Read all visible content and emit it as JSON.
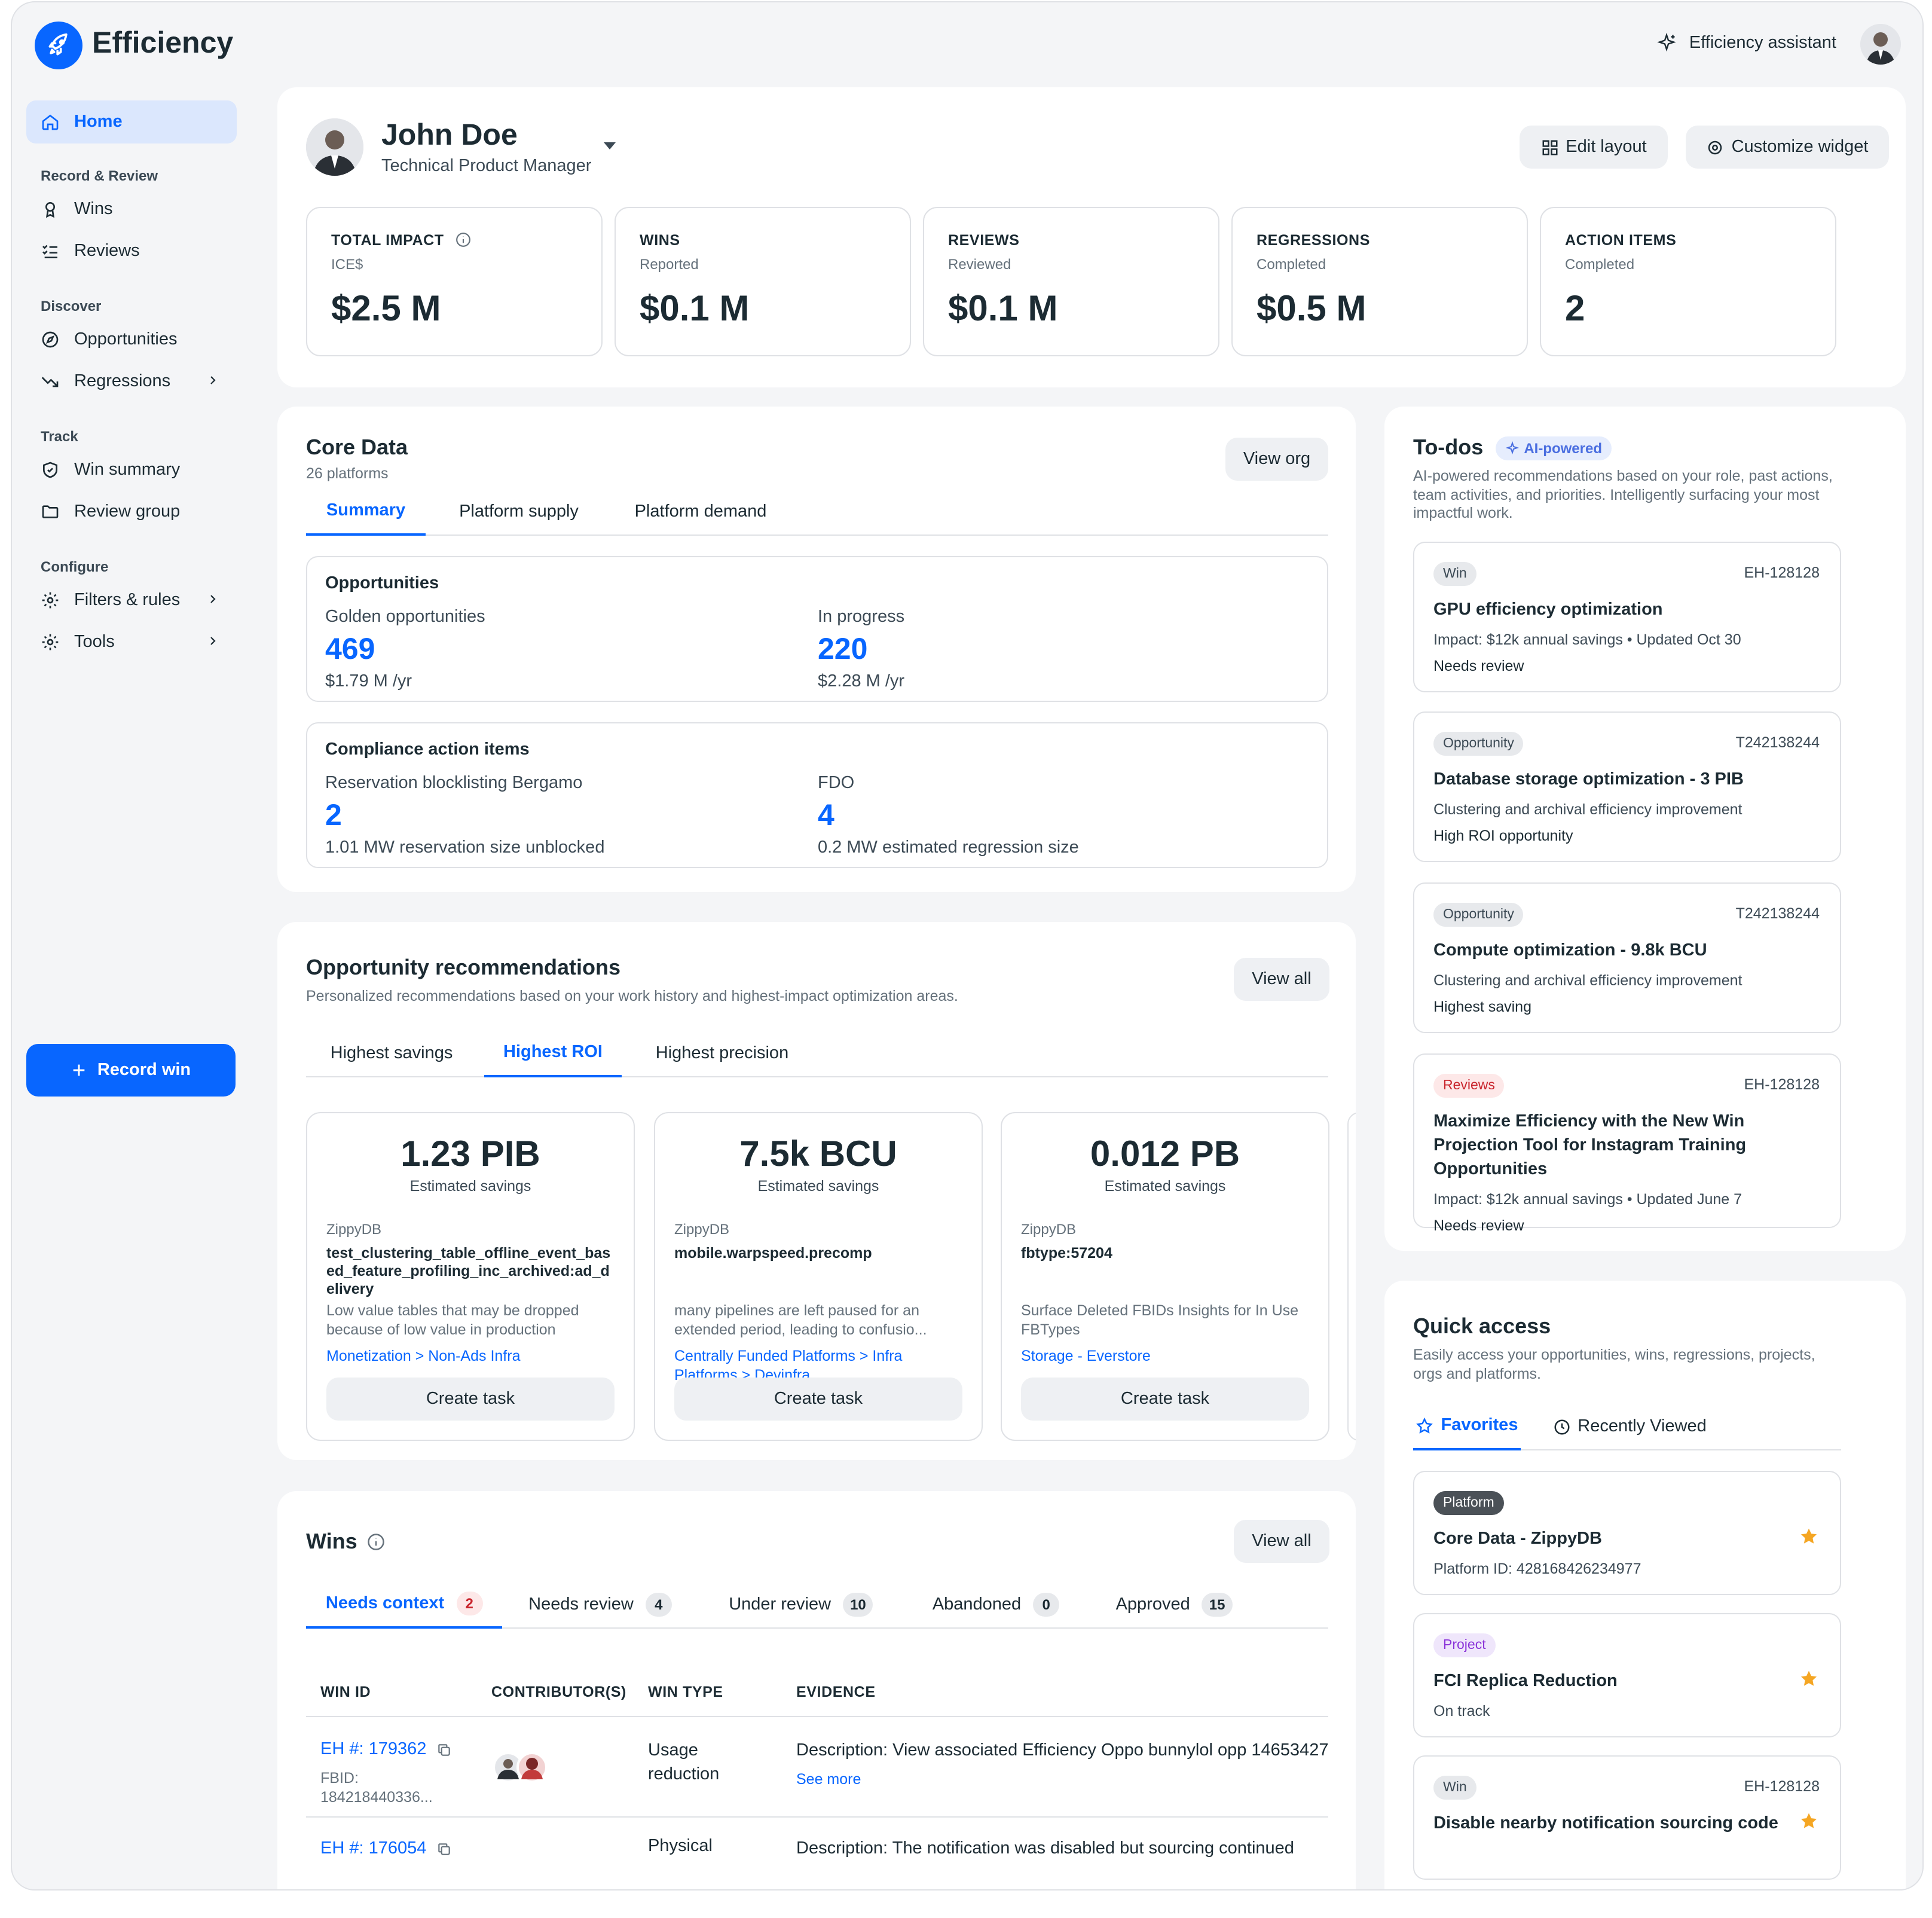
{
  "app": {
    "name": "Efficiency",
    "assistant_label": "Efficiency assistant"
  },
  "sidebar": {
    "home": "Home",
    "sections": [
      {
        "title": "Record & Review",
        "items": [
          "Wins",
          "Reviews"
        ]
      },
      {
        "title": "Discover",
        "items": [
          "Opportunities",
          "Regressions"
        ]
      },
      {
        "title": "Track",
        "items": [
          "Win summary",
          "Review group"
        ]
      },
      {
        "title": "Configure",
        "items": [
          "Filters & rules",
          "Tools"
        ]
      }
    ],
    "record_win": "Record win"
  },
  "profile": {
    "name": "John Doe",
    "role": "Technical Product Manager",
    "edit_layout": "Edit layout",
    "customize_widget": "Customize widget",
    "stats": [
      {
        "title": "TOTAL IMPACT",
        "sub": "ICE$",
        "value": "$2.5 M"
      },
      {
        "title": "WINS",
        "sub": "Reported",
        "value": "$0.1 M"
      },
      {
        "title": "REVIEWS",
        "sub": "Reviewed",
        "value": "$0.1 M"
      },
      {
        "title": "REGRESSIONS",
        "sub": "Completed",
        "value": "$0.5 M"
      },
      {
        "title": "ACTION ITEMS",
        "sub": "Completed",
        "value": "2"
      }
    ]
  },
  "core_data": {
    "title": "Core Data",
    "subtitle": "26 platforms",
    "view_org": "View org",
    "tabs": [
      "Summary",
      "Platform supply",
      "Platform demand"
    ],
    "opportunities": {
      "title": "Opportunities",
      "left": {
        "label": "Golden opportunities",
        "value": "469",
        "sub": "$1.79 M /yr"
      },
      "right": {
        "label": "In progress",
        "value": "220",
        "sub": "$2.28 M /yr"
      }
    },
    "compliance": {
      "title": "Compliance action items",
      "left": {
        "label": "Reservation blocklisting Bergamo",
        "value": "2",
        "sub": "1.01 MW reservation size unblocked"
      },
      "right": {
        "label": "FDO",
        "value": "4",
        "sub": "0.2 MW estimated regression size"
      }
    }
  },
  "recommendations": {
    "title": "Opportunity recommendations",
    "subtitle": "Personalized recommendations based on your work history and highest-impact optimization areas.",
    "view_all": "View all",
    "tabs": [
      "Highest savings",
      "Highest ROI",
      "Highest precision"
    ],
    "items": [
      {
        "value": "1.23 PIB",
        "est": "Estimated savings",
        "source": "ZippyDB",
        "name": "test_clustering_table_offline_event_based_feature_profiling_inc_archived:ad_delivery",
        "desc": "Low value tables that may be dropped because of low value in production",
        "link": "Monetization > Non-Ads Infra",
        "button": "Create task"
      },
      {
        "value": "7.5k BCU",
        "est": "Estimated savings",
        "source": "ZippyDB",
        "name": "mobile.warpspeed.precomp",
        "desc": "many pipelines are left paused for an extended period, leading to confusio...",
        "link": "Centrally Funded Platforms > Infra Platforms > Devinfra",
        "button": "Create task"
      },
      {
        "value": "0.012 PB",
        "est": "Estimated savings",
        "source": "ZippyDB",
        "name": "fbtype:57204",
        "desc": "Surface Deleted FBIDs Insights for In Use FBTypes",
        "link": "Storage - Everstore",
        "button": "Create task"
      }
    ]
  },
  "wins": {
    "title": "Wins",
    "view_all": "View all",
    "tabs": [
      {
        "label": "Needs context",
        "count": "2"
      },
      {
        "label": "Needs review",
        "count": "4"
      },
      {
        "label": "Under review",
        "count": "10"
      },
      {
        "label": "Abandoned",
        "count": "0"
      },
      {
        "label": "Approved",
        "count": "15"
      }
    ],
    "columns": [
      "WIN ID",
      "CONTRIBUTOR(S)",
      "WIN TYPE",
      "EVIDENCE"
    ],
    "rows": [
      {
        "id": "EH #: 179362",
        "fbid_label": "FBID:",
        "fbid": "184218440336...",
        "type": "Usage reduction",
        "evidence": "Description: View associated Efficiency Oppo bunnylol opp 14653427",
        "see_more": "See more"
      },
      {
        "id": "EH #: 176054",
        "type": "Physical",
        "evidence": "Description: The notification was disabled but sourcing continued"
      }
    ]
  },
  "todos": {
    "title": "To-dos",
    "badge": "AI-powered",
    "subtitle": "AI-powered recommendations based on your role, past actions, team activities, and priorities. Intelligently surfacing your most impactful work.",
    "items": [
      {
        "tag": "Win",
        "id": "EH-128128",
        "title": "GPU efficiency optimization",
        "desc": "Impact: $12k annual savings • Updated Oct 30",
        "footer": "Needs review"
      },
      {
        "tag": "Opportunity",
        "id": "T242138244",
        "title": "Database storage optimization - 3 PIB",
        "desc": "Clustering and archival efficiency improvement",
        "footer": "High ROI opportunity"
      },
      {
        "tag": "Opportunity",
        "id": "T242138244",
        "title": "Compute optimization - 9.8k BCU",
        "desc": "Clustering and archival efficiency improvement",
        "footer": "Highest saving"
      },
      {
        "tag": "Reviews",
        "id": "EH-128128",
        "title": "Maximize Efficiency with the New Win Projection Tool for Instagram Training Opportunities",
        "desc": "Impact: $12k annual savings • Updated June 7",
        "footer": "Needs review"
      }
    ]
  },
  "quick_access": {
    "title": "Quick access",
    "subtitle": "Easily access your opportunities, wins, regressions, projects, orgs and platforms.",
    "tabs": [
      "Favorites",
      "Recently Viewed"
    ],
    "items": [
      {
        "tag": "Platform",
        "title": "Core Data - ZippyDB",
        "desc": "Platform ID: 428168426234977"
      },
      {
        "tag": "Project",
        "title": "FCI Replica Reduction",
        "desc": "On track"
      },
      {
        "tag": "Win",
        "id": "EH-128128",
        "title": "Disable nearby notification sourcing code"
      }
    ]
  },
  "colors": {
    "accent": "#0866ff",
    "star": "#f5a623",
    "background": "#f4f5f7"
  }
}
